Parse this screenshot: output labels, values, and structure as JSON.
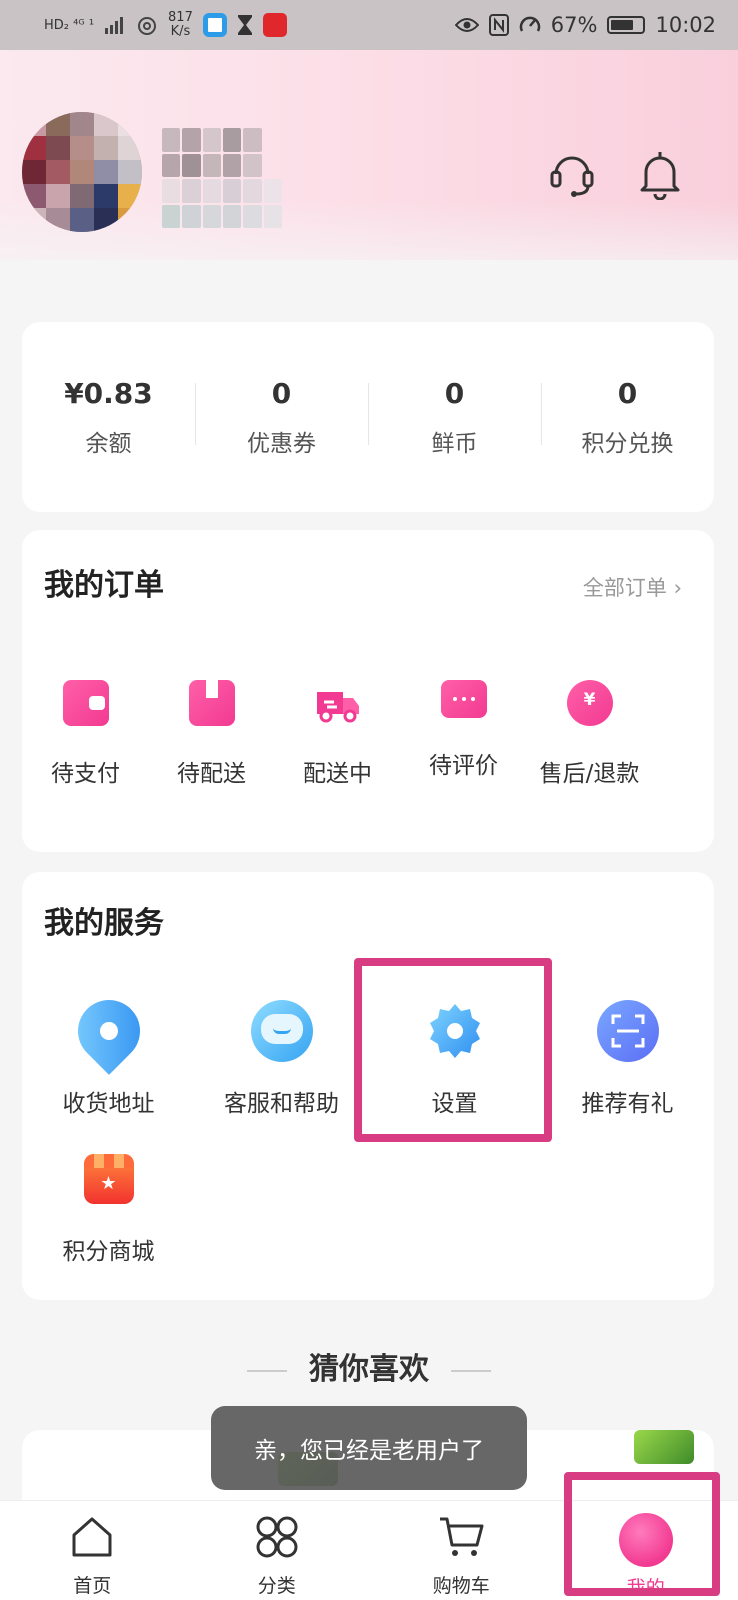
{
  "status_bar": {
    "left_text": "HD₂  ⁴ᴳ  ¹",
    "network_speed_value": "817",
    "network_speed_unit": "K/s",
    "battery": "67%",
    "time": "10:02"
  },
  "stats": [
    {
      "value": "¥0.83",
      "label": "余额"
    },
    {
      "value": "0",
      "label": "优惠券"
    },
    {
      "value": "0",
      "label": "鲜币"
    },
    {
      "value": "0",
      "label": "积分兑换"
    }
  ],
  "orders": {
    "title": "我的订单",
    "all_label": "全部订单 ›",
    "items": [
      {
        "label": "待支付",
        "icon": "wallet-icon"
      },
      {
        "label": "待配送",
        "icon": "box-icon"
      },
      {
        "label": "配送中",
        "icon": "truck-icon"
      },
      {
        "label": "待评价",
        "icon": "comment-icon"
      },
      {
        "label": "售后/退款",
        "icon": "refund-icon"
      }
    ]
  },
  "services": {
    "title": "我的服务",
    "items": [
      {
        "label": "收货地址",
        "icon": "location-pin-icon"
      },
      {
        "label": "客服和帮助",
        "icon": "headset-icon"
      },
      {
        "label": "设置",
        "icon": "gear-icon"
      },
      {
        "label": "推荐有礼",
        "icon": "scan-icon"
      },
      {
        "label": "积分商城",
        "icon": "store-icon"
      }
    ]
  },
  "guess_title": "猜你喜欢",
  "toast": "亲，您已经是老用户了",
  "bottom_nav": [
    {
      "label": "首页",
      "icon": "home-icon"
    },
    {
      "label": "分类",
      "icon": "category-icon"
    },
    {
      "label": "购物车",
      "icon": "cart-icon"
    },
    {
      "label": "我的",
      "icon": "me-icon"
    }
  ],
  "colors": {
    "accent": "#f23a92",
    "highlight": "#d83c82",
    "blue": "#3aa0f5"
  }
}
